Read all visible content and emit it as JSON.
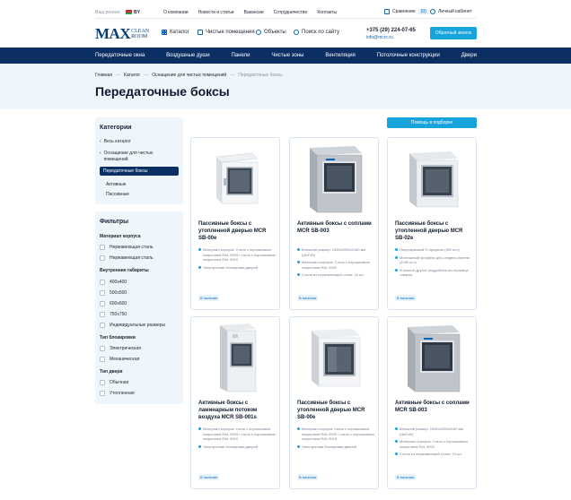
{
  "topbar": {
    "region_label": "Ваш регион:",
    "region_code": "BY",
    "nav": [
      "О компании",
      "Новости и статьи",
      "Вакансии",
      "Сотрудничество",
      "Контакты"
    ],
    "compare_label": "Сравнение",
    "compare_count": "(0)",
    "account_label": "Личный кабинет"
  },
  "header": {
    "logo_main": "MAX",
    "logo_clean": "CLEAN",
    "logo_room": "ROOM",
    "catalog": "Каталог",
    "clean_rooms": "Чистые помещения",
    "objects": "Объекты",
    "search": "Поиск по сайту",
    "phone": "+375 (29) 224-07-65",
    "email": "info@mcrc.ru",
    "callback": "Обратный звонок"
  },
  "mainnav": [
    "Передаточные окна",
    "Воздушные души",
    "Панели",
    "Чистые зоны",
    "Вентиляция",
    "Потолочные конструкции",
    "Двери"
  ],
  "breadcrumb": [
    "Главная",
    "Каталог",
    "Оснащение для чистых помещений",
    "Передаточные боксы"
  ],
  "breadcrumb_sep": "—",
  "page_title": "Передаточные боксы",
  "help_button": "Помощь в подборке",
  "categories": {
    "title": "Категории",
    "all": "Весь каталог",
    "parent": "Оснащение для чистых помещений",
    "active": "Передаточные боксы",
    "children": [
      "Активные",
      "Пассивные"
    ]
  },
  "filters": {
    "title": "Фильтры",
    "groups": [
      {
        "name": "Материал корпуса",
        "items": [
          "Нержавеющая сталь",
          "Нержавеющая сталь"
        ]
      },
      {
        "name": "Внутренние габариты",
        "items": [
          "400х400",
          "500х500",
          "600х600",
          "750х750",
          "Индивидуальные размеры"
        ]
      },
      {
        "name": "Тип блокировки",
        "items": [
          "Электрическая",
          "Механическая"
        ]
      },
      {
        "name": "Тип двери",
        "items": [
          "Обычная",
          "Утопленная"
        ]
      }
    ]
  },
  "products": [
    {
      "title": "Пассивные боксы с утопленной дверью MCR SB-00e",
      "features": [
        "Материал корпуса: Сталь с порошковым покрытием RAL 9003 / сталь с порошковым покрытием RAL 9010",
        "Электронная блокировка дверей"
      ],
      "stock": "В наличии"
    },
    {
      "title": "Активные боксы с соплами MCR SB-003",
      "features": [
        "Внешний размер: 1450х2000х2180 мм (ШхГхВ)",
        "Материал корпуса: Сталь с порошковым покрытием RAL 9003",
        "Сопла из нержавеющей стали: 24 шт."
      ],
      "stock": "В наличии"
    },
    {
      "title": "Пассивные боксы с утопленной дверью MCR SB-02e",
      "features": [
        "Непрозрачный П-профиль (500 м.п)",
        "Монтажный профиль для сэндвич-панели (1000 м.п)",
        "И многое другое (подробнее на странице товара)"
      ],
      "stock": "В наличии"
    },
    {
      "title": "Активные боксы с ламинарным потоком воздуха MCR SB-001s",
      "features": [
        "Материал корпуса: сталь с порошковым покрытием RAL 9003 / сталь с порошковым покрытием RAL 9010",
        "Электронная блокировка дверей"
      ],
      "stock": "В наличии"
    },
    {
      "title": "Пассивные боксы с утопленной дверью MCR SB-00e",
      "features": [
        "Материал корпуса: сталь с порошковым покрытием RAL 9003 / сталь с порошковым покрытием RAL 9010",
        "Электронная блокировка дверей"
      ],
      "stock": "В наличии"
    },
    {
      "title": "Активные боксы с соплами MCR SB-003",
      "features": [
        "Внешний размер: 1000х2000х2180 мм (ШхГхВ)",
        "Материал корпуса: Сталь с порошковым покрытием RAL 9003",
        "Сопла из нержавеющей стали: 24 шт."
      ],
      "stock": "В наличии"
    }
  ]
}
